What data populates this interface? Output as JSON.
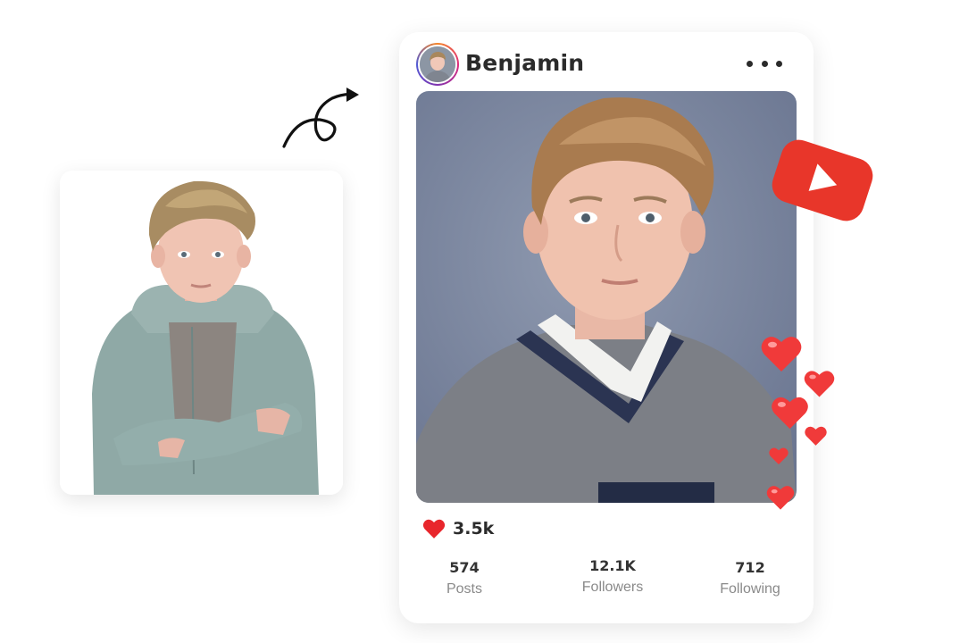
{
  "profile": {
    "username": "Benjamin",
    "menu_icon": "more-dots-icon"
  },
  "post": {
    "likes": "3.5k",
    "like_icon": "heart-icon"
  },
  "stats": [
    {
      "value": "574",
      "label": "Posts"
    },
    {
      "value": "12.1K",
      "label": "Followers"
    },
    {
      "value": "712",
      "label": "Following"
    }
  ],
  "icons": {
    "youtube": "youtube-play-icon",
    "arrow": "curly-arrow-icon",
    "hearts": "floating-heart-icon"
  },
  "colors": {
    "youtube_red": "#e8362a",
    "heart_red": "#f03a3a",
    "text_dark": "#2b2b2b",
    "text_muted": "#8a8a8a"
  }
}
